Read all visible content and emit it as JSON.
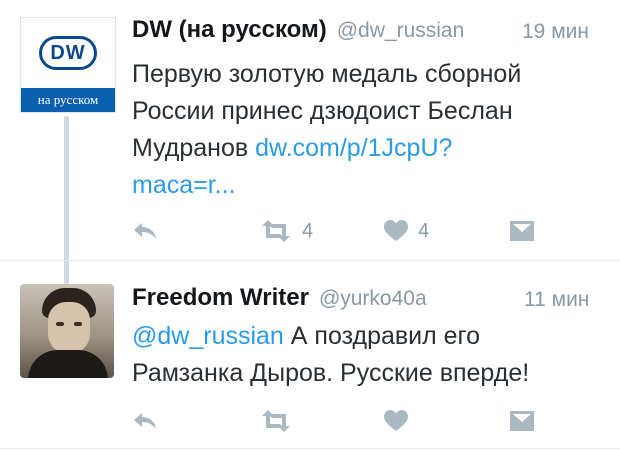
{
  "tweets": [
    {
      "avatar_label": "на русском",
      "avatar_logo": "DW",
      "name": "DW (на русском)",
      "handle": "@dw_russian",
      "time": "19 мин",
      "text_lines": [
        "Первую золотую медаль сборной",
        "России принес дзюдоист Беслан",
        "Мудранов "
      ],
      "link_line1": "dw.com/p/1JcpU?",
      "link_line2": "maca=r...",
      "retweets": "4",
      "likes": "4"
    },
    {
      "name": "Freedom Writer",
      "handle": "@yurko40a",
      "time": "11 мин",
      "mention": "@dw_russian",
      "text_line1": " А поздравил его",
      "text_line2": "Рамзанка Дыров. Русские вперде!"
    }
  ],
  "icons": [
    "reply-icon",
    "retweet-icon",
    "like-icon",
    "dm-icon"
  ],
  "colors": {
    "link": "#2a9be6",
    "icon": "#aab8c2",
    "dw_blue": "#0a4a8c"
  }
}
